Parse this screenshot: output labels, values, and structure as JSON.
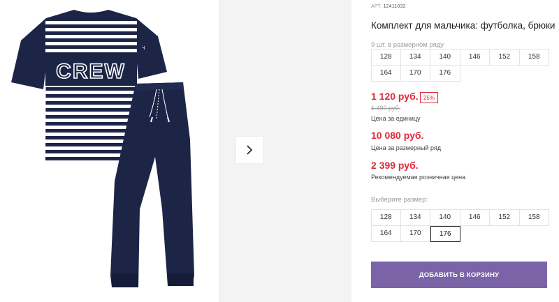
{
  "product": {
    "article_label": "АРТ.",
    "article_value": "12411032",
    "title": "Комплект для мальчика: футболка, брюки",
    "pieces_note": "9 шт. в размерном ряду",
    "image_print_text": "CREW"
  },
  "size_row": {
    "sizes": [
      "128",
      "134",
      "140",
      "146",
      "152",
      "158",
      "164",
      "170",
      "176"
    ]
  },
  "prices": {
    "unit_price": "1 120 руб.",
    "discount_badge": "25%",
    "old_price": "1 490 руб.",
    "unit_label": "Цена за единицу",
    "row_price": "10 080 руб.",
    "row_label": "Цена за размерный ряд",
    "retail_price": "2 399 руб.",
    "retail_label": "Рекомендуемая розничная цена"
  },
  "size_select": {
    "label": "Выберите размер:",
    "sizes": [
      "128",
      "134",
      "140",
      "146",
      "152",
      "158",
      "164",
      "170",
      "176"
    ],
    "selected": "176"
  },
  "cart": {
    "button_label": "ДОБАВИТЬ В КОРЗИНУ"
  },
  "colors": {
    "accent_red": "#e0283a",
    "button_purple": "#7b63a8",
    "navy": "#1d2547"
  },
  "icons": {
    "next_arrow": "chevron-right-icon"
  }
}
